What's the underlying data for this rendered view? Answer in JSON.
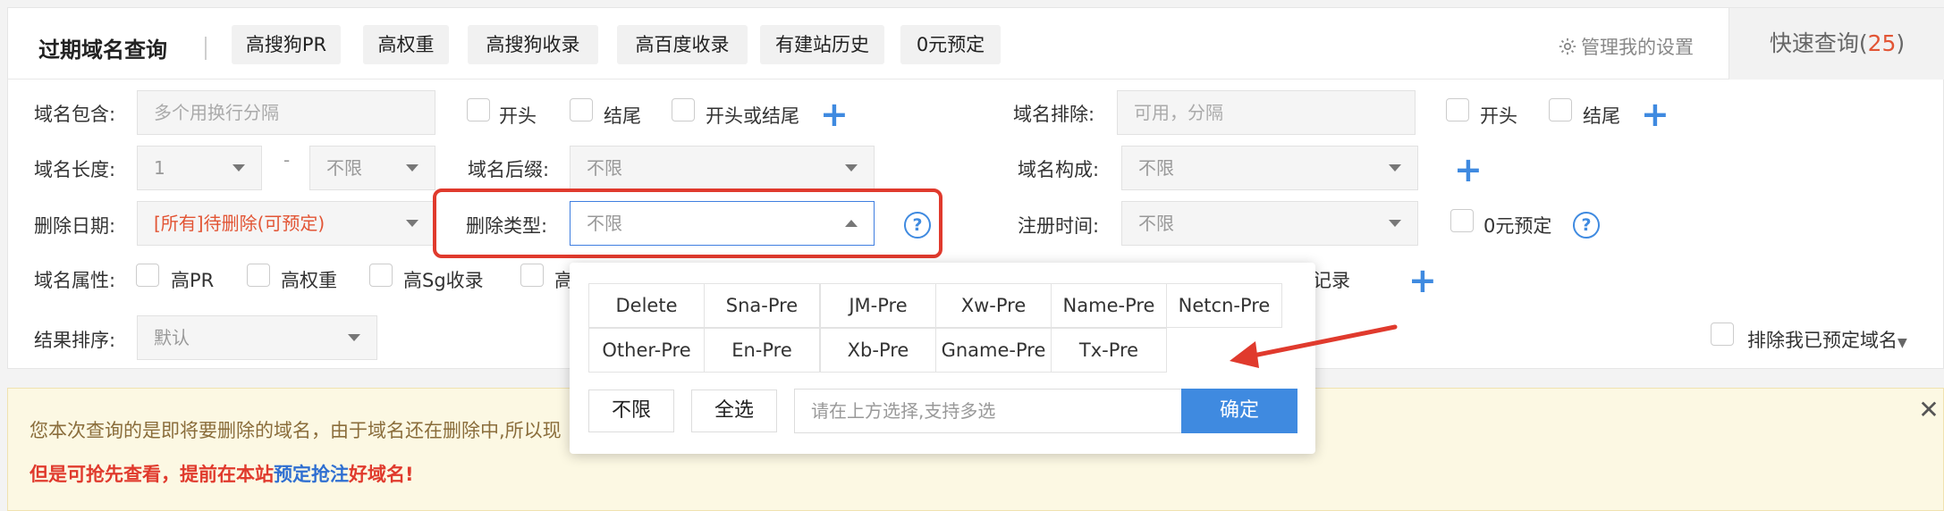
{
  "header": {
    "title": "过期域名查询",
    "tags": [
      "高搜狗PR",
      "高权重",
      "高搜狗收录",
      "高百度收录",
      "有建站历史",
      "0元预定"
    ],
    "settings": "管理我的设置",
    "quick_label": "快速查询(",
    "quick_count": "25",
    "quick_close": ")"
  },
  "filters": {
    "contains_label": "域名包含:",
    "contains_placeholder": "多个用换行分隔",
    "starts": "开头",
    "ends": "结尾",
    "starts_or_ends": "开头或结尾",
    "exclude_label": "域名排除:",
    "exclude_placeholder": "可用，分隔",
    "length_label": "域名长度:",
    "length_min": "1",
    "length_sep": "-",
    "length_max": "不限",
    "suffix_label": "域名后缀:",
    "suffix_value": "不限",
    "composition_label": "域名构成:",
    "composition_value": "不限",
    "delete_date_label": "删除日期:",
    "delete_date_value": "[所有]待删除(可预定)",
    "delete_type_label": "删除类型:",
    "delete_type_value": "不限",
    "reg_time_label": "注册时间:",
    "reg_time_value": "不限",
    "zero_preorder": "0元预定",
    "attr_label": "域名属性:",
    "attrs": [
      "高PR",
      "高权重",
      "高Sg收录",
      "高"
    ],
    "attr_right": "记录",
    "sort_label": "结果排序:",
    "sort_value": "默认",
    "exclude_reserved": "排除我已预定域名",
    "help_glyph": "?"
  },
  "dropdown": {
    "options_row1": [
      "Delete",
      "Sna-Pre",
      "JM-Pre",
      "Xw-Pre",
      "Name-Pre",
      "Netcn-Pre"
    ],
    "options_row2": [
      "Other-Pre",
      "En-Pre",
      "Xb-Pre",
      "Gname-Pre",
      "Tx-Pre"
    ],
    "btn_unlimited": "不限",
    "btn_all": "全选",
    "input_placeholder": "请在上方选择,支持多选",
    "btn_ok": "确定"
  },
  "notice": {
    "line1": "您本次查询的是即将要删除的域名，由于域名还在删除中,所以现",
    "line2_a": "但是可抢先查看，提前在本站",
    "line2_link": "预定抢注",
    "line2_b": "好域名!",
    "close": "✕"
  },
  "colors": {
    "accent": "#3f8ae0",
    "highlight": "#e03a2d",
    "red_text": "#e25535",
    "notice_bg": "#fcf8e3"
  }
}
